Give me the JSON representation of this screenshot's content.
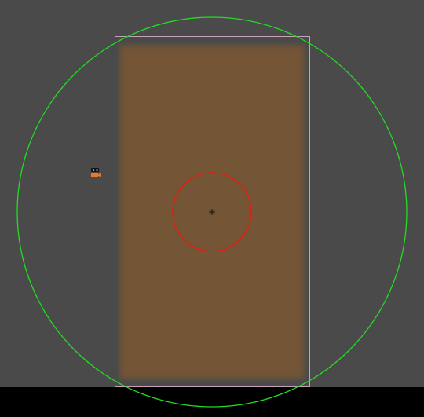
{
  "scene": {
    "background_color": "#4a4a4a",
    "bottom_bar_color": "#000000"
  },
  "sprite": {
    "fill_color": "#745536",
    "outline_color": "#c8a0b8"
  },
  "gizmos": {
    "outer_radius_color": "#22dd22",
    "inner_radius_color": "#dd2211",
    "pivot_icon": "crosshair-icon"
  },
  "camera": {
    "icon": "camera-icon",
    "color": "#e8782a"
  }
}
